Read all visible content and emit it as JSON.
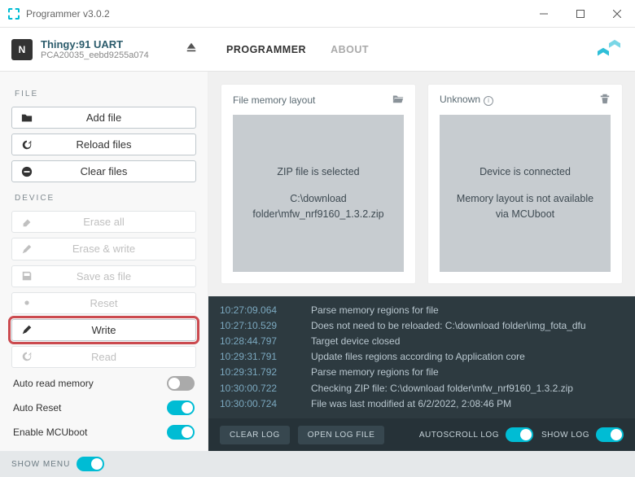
{
  "window": {
    "title": "Programmer v3.0.2"
  },
  "device": {
    "name": "Thingy:91 UART",
    "serial": "PCA20035_eebd9255a074"
  },
  "tabs": {
    "programmer": "PROGRAMMER",
    "about": "ABOUT"
  },
  "sections": {
    "file": "FILE",
    "device": "DEVICE"
  },
  "buttons": {
    "add_file": "Add file",
    "reload_files": "Reload files",
    "clear_files": "Clear files",
    "erase_all": "Erase all",
    "erase_write": "Erase & write",
    "save_as_file": "Save as file",
    "reset": "Reset",
    "write": "Write",
    "read": "Read"
  },
  "toggles": {
    "auto_read": "Auto read memory",
    "auto_reset": "Auto Reset",
    "enable_mcuboot": "Enable MCUboot"
  },
  "panels": {
    "file": {
      "title": "File memory layout",
      "line1": "ZIP file is selected",
      "line2": "C:\\download folder\\mfw_nrf9160_1.3.2.zip"
    },
    "unknown": {
      "title": "Unknown",
      "line1": "Device is connected",
      "line2": "Memory layout is not available via MCUboot"
    }
  },
  "log": [
    {
      "ts": "10:27:09.064",
      "msg": "Parse memory regions for file"
    },
    {
      "ts": "10:27:10.529",
      "msg": "Does not need to be reloaded: C:\\download folder\\img_fota_dfu"
    },
    {
      "ts": "10:28:44.797",
      "msg": "Target device closed"
    },
    {
      "ts": "10:29:31.791",
      "msg": "Update files regions according to Application core"
    },
    {
      "ts": "10:29:31.792",
      "msg": "Parse memory regions for file"
    },
    {
      "ts": "10:30:00.722",
      "msg": "Checking ZIP file: C:\\download folder\\mfw_nrf9160_1.3.2.zip"
    },
    {
      "ts": "10:30:00.724",
      "msg": "File was last modified at 6/2/2022, 2:08:46 PM"
    }
  ],
  "log_footer": {
    "clear": "CLEAR LOG",
    "open": "OPEN LOG FILE",
    "autoscroll": "AUTOSCROLL LOG",
    "show": "SHOW LOG"
  },
  "bottom": {
    "show_menu": "SHOW MENU"
  }
}
